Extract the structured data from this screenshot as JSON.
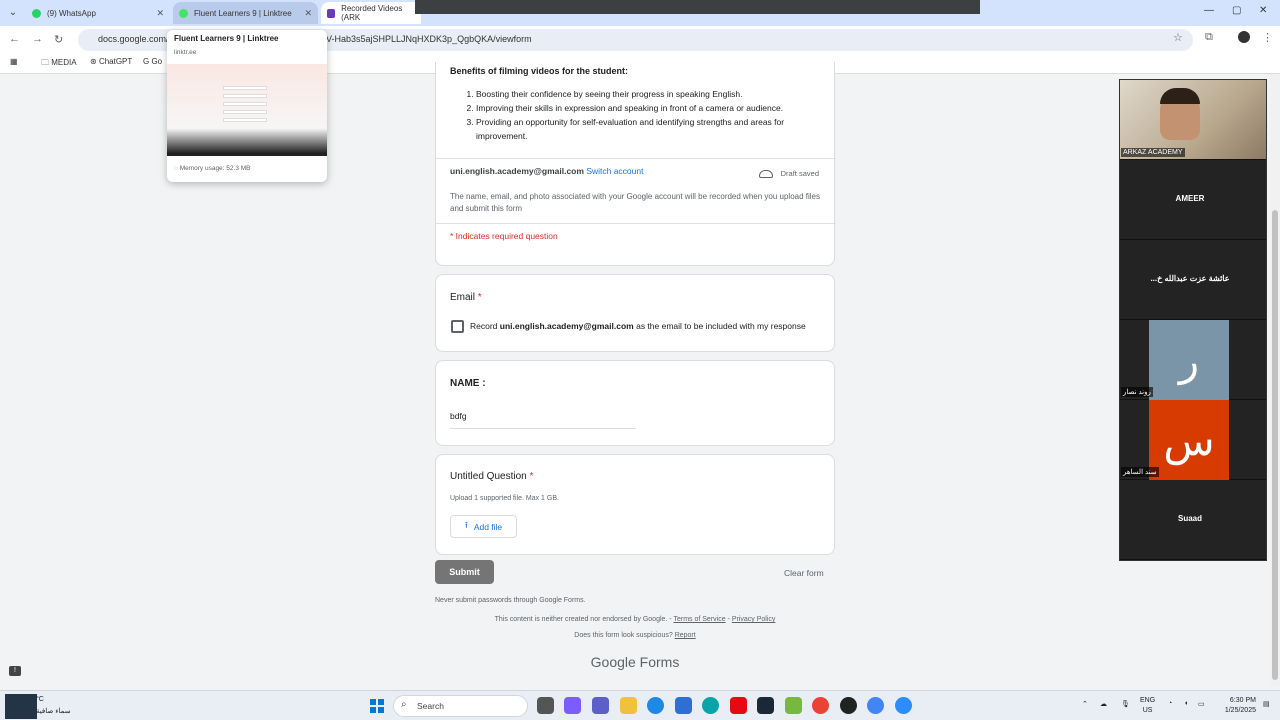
{
  "browser": {
    "tabs": [
      {
        "title": "(9) WhatsApp",
        "color": "#25d366"
      },
      {
        "title": "Fluent Learners 9 | Linktree",
        "color": "#43e660"
      },
      {
        "title": "Recorded Videos (ARK",
        "color": "#673ab7"
      }
    ],
    "url_left": "docs.google.com/",
    "url_right": "V-Hab3s5ajSHPLLJNqHXDK3p_QgbQKA/viewform",
    "bookmarks": [
      "MEDIA",
      "ChatGPT",
      "Go"
    ]
  },
  "tab_preview": {
    "title": "Fluent Learners 9 | Linktree",
    "domain": "linktr.ee",
    "memory": "Memory usage: 52.3 MB"
  },
  "form": {
    "benefits_title": "Benefits of filming videos for the student:",
    "benefits": [
      "Boosting their confidence by seeing their progress in speaking English.",
      "Improving their skills in expression and speaking in front of a camera or audience.",
      "Providing an opportunity for self-evaluation and identifying strengths and areas for improvement."
    ],
    "account_email": "uni.english.academy@gmail.com",
    "switch_account": "Switch account",
    "draft_status": "Draft saved",
    "notice": "The name, email, and photo associated with your Google account will be recorded when you upload files and submit this form",
    "required_note": "* Indicates required question",
    "email_question": "Email",
    "email_checkbox_prefix": "Record",
    "email_checkbox_email": "uni.english.academy@gmail.com",
    "email_checkbox_suffix": "as the email to be included with my response",
    "name_question": "NAME :",
    "name_value": "bdfg",
    "upload_question": "Untitled Question",
    "upload_hint": "Upload 1 supported file. Max 1 GB.",
    "add_file": "Add file",
    "submit": "Submit",
    "clear_form": "Clear form",
    "never_submit": "Never submit passwords through Google Forms.",
    "disclaimer_prefix": "This content is neither created nor endorsed by Google. -",
    "terms": "Terms of Service",
    "privacy": "Privacy Policy",
    "suspicious_prefix": "Does this form look suspicious?",
    "report": "Report",
    "logo": "Google Forms"
  },
  "meeting": {
    "participants": [
      {
        "name": "ARKAZ ACADEMY",
        "type": "video"
      },
      {
        "name": "AMEER",
        "type": "name"
      },
      {
        "name": "عائشة عزت عبدالله خ...",
        "type": "name"
      },
      {
        "name": "روند نصار",
        "type": "avatar",
        "initial": "ر",
        "color": "#7b95a8"
      },
      {
        "name": "سند الساهر",
        "type": "avatar",
        "initial": "س",
        "color": "#d83b01"
      },
      {
        "name": "Suaad",
        "type": "name"
      }
    ]
  },
  "taskbar": {
    "weather_temp": "°C",
    "weather_cond": "سماء صافية",
    "search": "Search",
    "lang_top": "ENG",
    "lang_bottom": "US",
    "time": "6:30 PM",
    "date": "1/25/2025"
  }
}
